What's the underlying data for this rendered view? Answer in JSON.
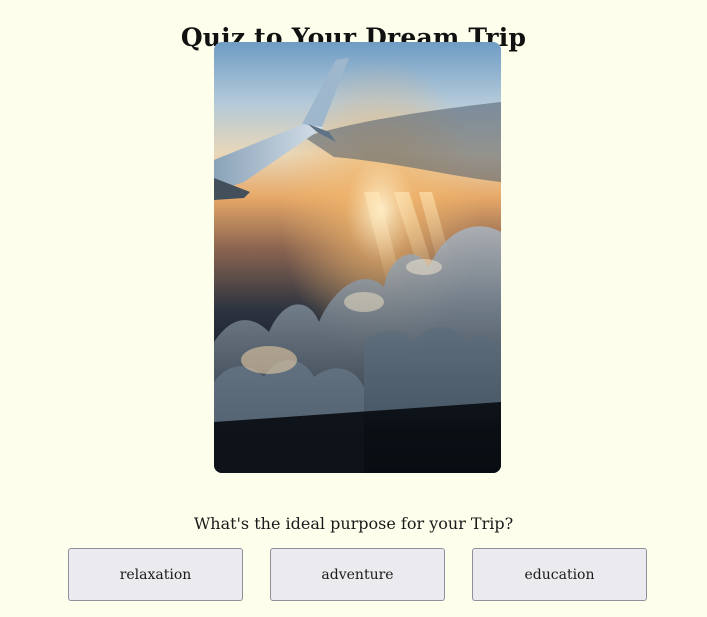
{
  "page": {
    "title": "Quiz to Your Dream Trip"
  },
  "hero_image": {
    "alt": "Airplane wing above clouds at sunset"
  },
  "quiz": {
    "question": "What's the ideal purpose for your Trip?",
    "answers": [
      {
        "label": "relaxation"
      },
      {
        "label": "adventure"
      },
      {
        "label": "education"
      }
    ]
  },
  "colors": {
    "background": "#fefeec",
    "button_bg": "#ebebef",
    "button_border": "#8f8f9d",
    "text": "#1a1a1a"
  }
}
